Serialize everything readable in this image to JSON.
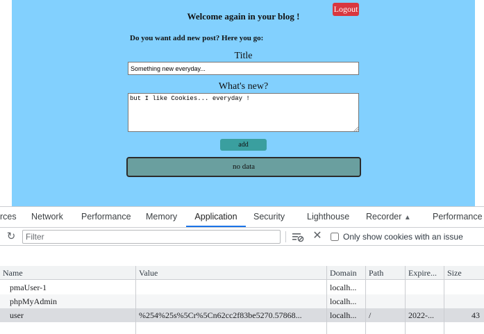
{
  "page": {
    "welcome": "Welcome again in your blog !",
    "logout_label": "Logout",
    "question": "Do you want add new post? Here you go:",
    "title_label": "Title",
    "title_value": "Something new everyday...",
    "content_label": "What's new?",
    "content_value": "but I like Cookies... everyday !",
    "add_label": "add",
    "no_data": "no data",
    "colors": {
      "background": "#82d0fe",
      "logout": "#d9373f",
      "add": "#3a9f9f",
      "no_data": "#6a9f9f"
    }
  },
  "devtools": {
    "tabs": [
      {
        "label": "rces"
      },
      {
        "label": "Network"
      },
      {
        "label": "Performance"
      },
      {
        "label": "Memory"
      },
      {
        "label": "Application",
        "active": true
      },
      {
        "label": "Security"
      },
      {
        "label": "Lighthouse"
      },
      {
        "label": "Recorder",
        "icon": "flask-icon"
      },
      {
        "label": "Performance"
      }
    ],
    "toolbar": {
      "refresh_icon": "refresh-icon",
      "filter_placeholder": "Filter",
      "clear_filtered_icon": "clear-filtered-icon",
      "clear_all_icon": "close-icon",
      "only_issue_label": "Only show cookies with an issue",
      "only_issue_checked": false
    },
    "table": {
      "columns": [
        "Name",
        "Value",
        "Domain",
        "Path",
        "Expire...",
        "Size"
      ],
      "rows": [
        {
          "name": "pmaUser-1",
          "value": "",
          "domain": "localh...",
          "path": "",
          "expires": "",
          "size": ""
        },
        {
          "name": "phpMyAdmin",
          "value": "",
          "domain": "localh...",
          "path": "",
          "expires": "",
          "size": ""
        },
        {
          "name": "user",
          "value": "%254%25s%5Cr%5Cn62cc2f83be5270.57868...",
          "domain": "localh...",
          "path": "/",
          "expires": "2022-...",
          "size": "43"
        }
      ]
    }
  }
}
